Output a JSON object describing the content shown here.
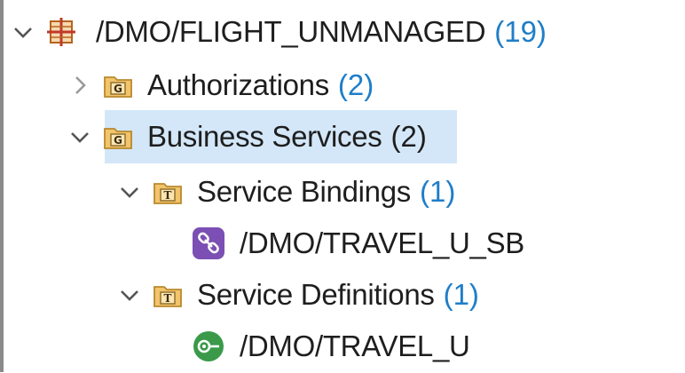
{
  "tree": {
    "root": {
      "label": "/DMO/FLIGHT_UNMANAGED",
      "count": "(19)",
      "icon": "package-icon"
    },
    "nodes": [
      {
        "label": "Authorizations",
        "count": "(2)",
        "icon": "folder-g-icon",
        "expanded": false
      },
      {
        "label": "Business Services",
        "count": "(2)",
        "icon": "folder-g-icon",
        "expanded": true,
        "selected": true
      },
      {
        "label": "Service Bindings",
        "count": "(1)",
        "icon": "folder-t-icon",
        "expanded": true
      },
      {
        "label": "/DMO/TRAVEL_U_SB",
        "icon": "service-binding-icon"
      },
      {
        "label": "Service Definitions",
        "count": "(1)",
        "icon": "folder-t-icon",
        "expanded": true
      },
      {
        "label": "/DMO/TRAVEL_U",
        "icon": "service-definition-icon"
      }
    ]
  },
  "colors": {
    "count": "#1f7ec8",
    "selection": "#d3e7f8",
    "folder": "#f2c46b",
    "binding": "#7b4fb3",
    "definition": "#3a9a4a",
    "package": "#c0392b"
  }
}
